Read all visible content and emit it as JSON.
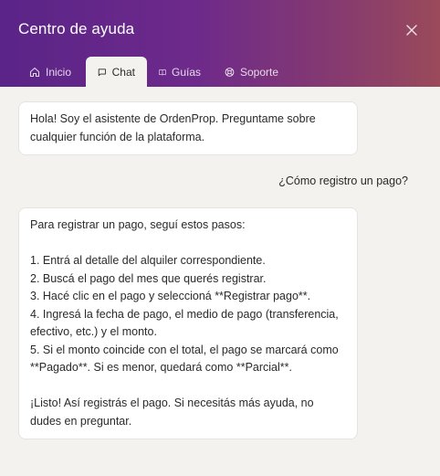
{
  "header": {
    "title": "Centro de ayuda",
    "close_icon": "close-icon"
  },
  "tabs": [
    {
      "label": "Inicio",
      "icon": "home-icon",
      "active": false
    },
    {
      "label": "Chat",
      "icon": "chat-icon",
      "active": true
    },
    {
      "label": "Guías",
      "icon": "book-icon",
      "active": false
    },
    {
      "label": "Soporte",
      "icon": "lifebuoy-icon",
      "active": false
    }
  ],
  "messages": {
    "bot_greeting": {
      "lines": [
        "Hola! Soy el asistente de OrdenProp. Preguntame sobre",
        "cualquier función de la plataforma."
      ]
    },
    "user_question": "¿Cómo registro un pago?",
    "bot_answer": {
      "lines": [
        "Para registrar un pago, seguí estos pasos:",
        "",
        "1. Entrá al detalle del alquiler correspondiente.",
        "2. Buscá el pago del mes que querés registrar.",
        "3. Hacé clic en el pago y seleccioná **Registrar pago**.",
        "4. Ingresá la fecha de pago, el medio de pago (transferencia,",
        "efectivo, etc.) y el monto.",
        "5. Si el monto coincide con el total, el pago se marcará como",
        "**Pagado**. Si es menor, quedará como **Parcial**.",
        "",
        "¡Listo! Así registrás el pago. Si necesitás más ayuda, no",
        "dudes en preguntar."
      ]
    }
  },
  "colors": {
    "header_gradient_start": "#5a2488",
    "header_gradient_end": "#9a4a5a",
    "background": "#f3f2ef",
    "bubble": "#ffffff"
  }
}
